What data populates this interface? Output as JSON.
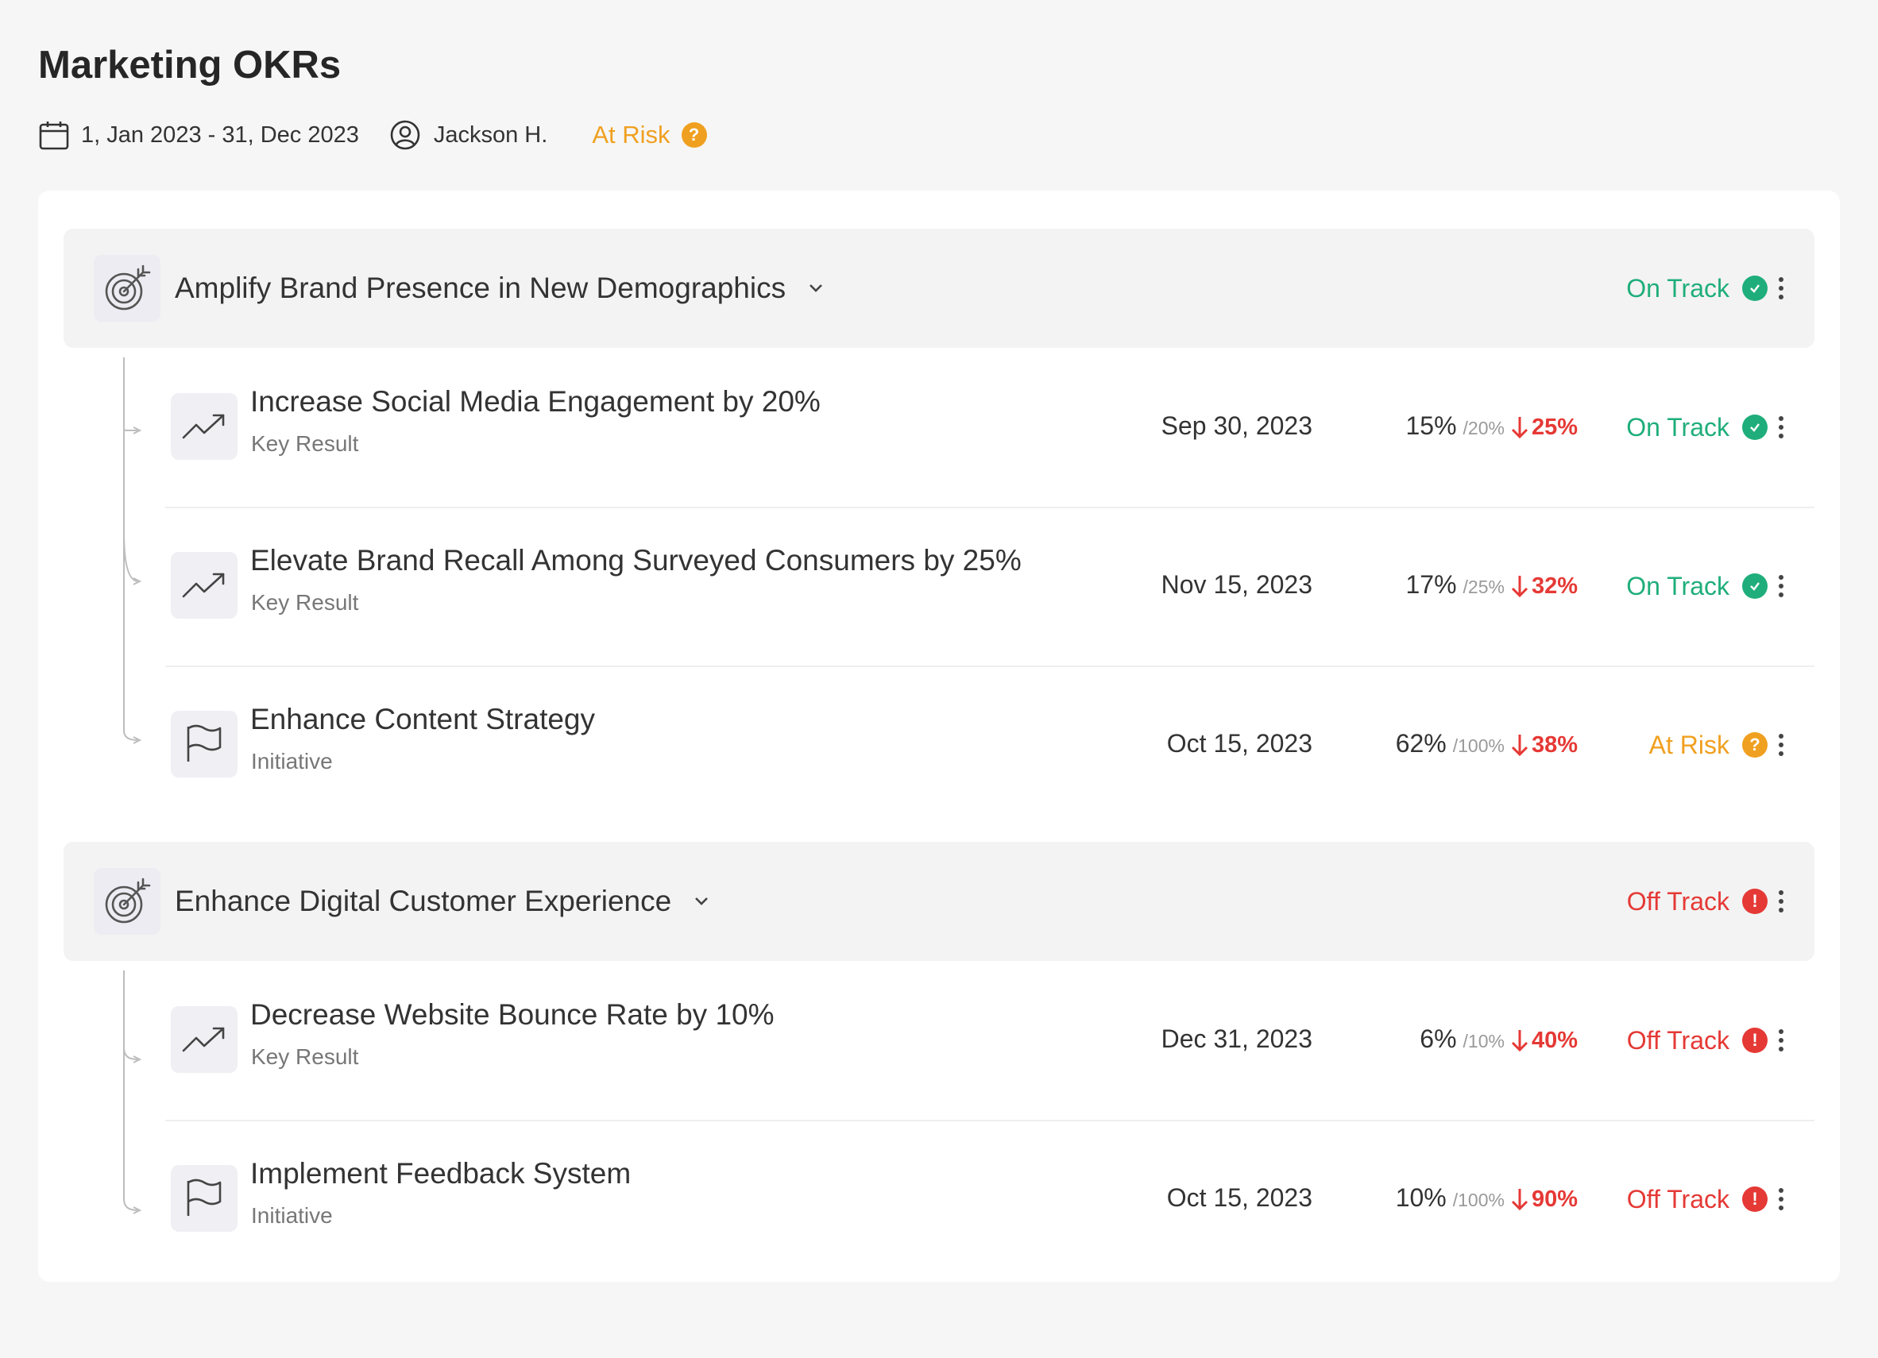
{
  "page": {
    "title": "Marketing OKRs",
    "date_range": "1, Jan 2023 - 31, Dec 2023",
    "owner": "Jackson H.",
    "status": "At Risk",
    "status_icon": "question-icon"
  },
  "status_colors": {
    "on_track": "#1fae7b",
    "at_risk": "#f0a020",
    "off_track": "#e53935"
  },
  "objectives": [
    {
      "title": "Amplify Brand Presence in New Demographics",
      "icon": "target-icon",
      "status": "On Track",
      "items": [
        {
          "title": "Increase Social Media Engagement by 20%",
          "type": "Key Result",
          "icon": "trending-up-icon",
          "date": "Sep 30, 2023",
          "progress": "15%",
          "target": "/20%",
          "delta": "25%",
          "status": "On Track"
        },
        {
          "title": "Elevate Brand Recall Among Surveyed Consumers by 25%",
          "type": "Key Result",
          "icon": "trending-up-icon",
          "date": "Nov 15, 2023",
          "progress": "17%",
          "target": "/25%",
          "delta": "32%",
          "status": "On Track"
        },
        {
          "title": "Enhance Content Strategy",
          "type": "Initiative",
          "icon": "flag-icon",
          "date": "Oct 15, 2023",
          "progress": "62%",
          "target": "/100%",
          "delta": "38%",
          "status": "At Risk"
        }
      ]
    },
    {
      "title": "Enhance Digital Customer Experience",
      "icon": "target-icon",
      "status": "Off Track",
      "items": [
        {
          "title": "Decrease Website Bounce Rate by 10%",
          "type": "Key Result",
          "icon": "trending-up-icon",
          "date": "Dec 31, 2023",
          "progress": "6%",
          "target": "/10%",
          "delta": "40%",
          "status": "Off Track"
        },
        {
          "title": "Implement Feedback System",
          "type": "Initiative",
          "icon": "flag-icon",
          "date": "Oct 15, 2023",
          "progress": "10%",
          "target": "/100%",
          "delta": "90%",
          "status": "Off Track"
        }
      ]
    }
  ]
}
